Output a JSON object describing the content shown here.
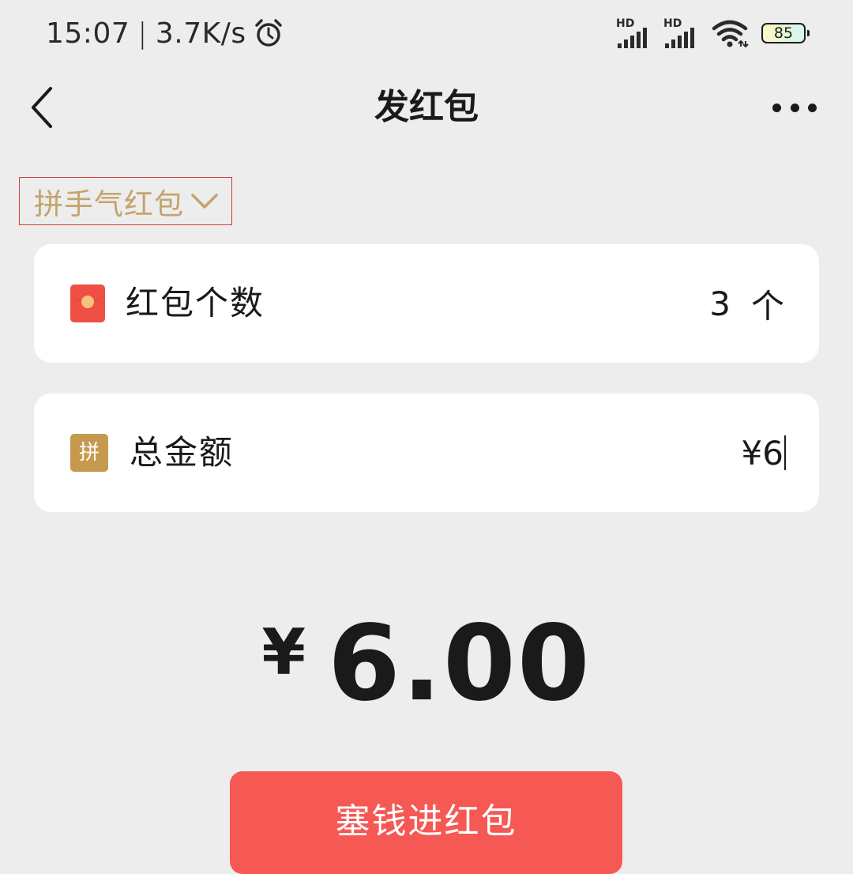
{
  "status_bar": {
    "time": "15:07",
    "separator": "|",
    "network_speed": "3.7K/s",
    "alarm_icon": "alarm-clock-icon",
    "signal_label_1": "HD",
    "signal_label_2": "HD",
    "wifi_icon": "wifi-icon",
    "battery_level": "85"
  },
  "nav": {
    "back_icon": "chevron-left-icon",
    "title": "发红包",
    "more_icon": "more-dots-icon"
  },
  "type_selector": {
    "label": "拼手气红包",
    "icon": "chevron-down-icon"
  },
  "count_card": {
    "icon": "red-packet-icon",
    "label": "红包个数",
    "value": "3",
    "unit": "个"
  },
  "amount_card": {
    "icon_text": "拼",
    "label": "总金额",
    "value": "¥6"
  },
  "total": {
    "currency": "¥",
    "amount": "6.00"
  },
  "submit": {
    "label": "塞钱进红包"
  },
  "colors": {
    "background": "#EDEDED",
    "accent_gold": "#C4A46C",
    "pin_badge": "#C69A4E",
    "red_packet": "#EE5043",
    "submit_button": "#F65854",
    "selector_outline": "#D13A3A"
  }
}
